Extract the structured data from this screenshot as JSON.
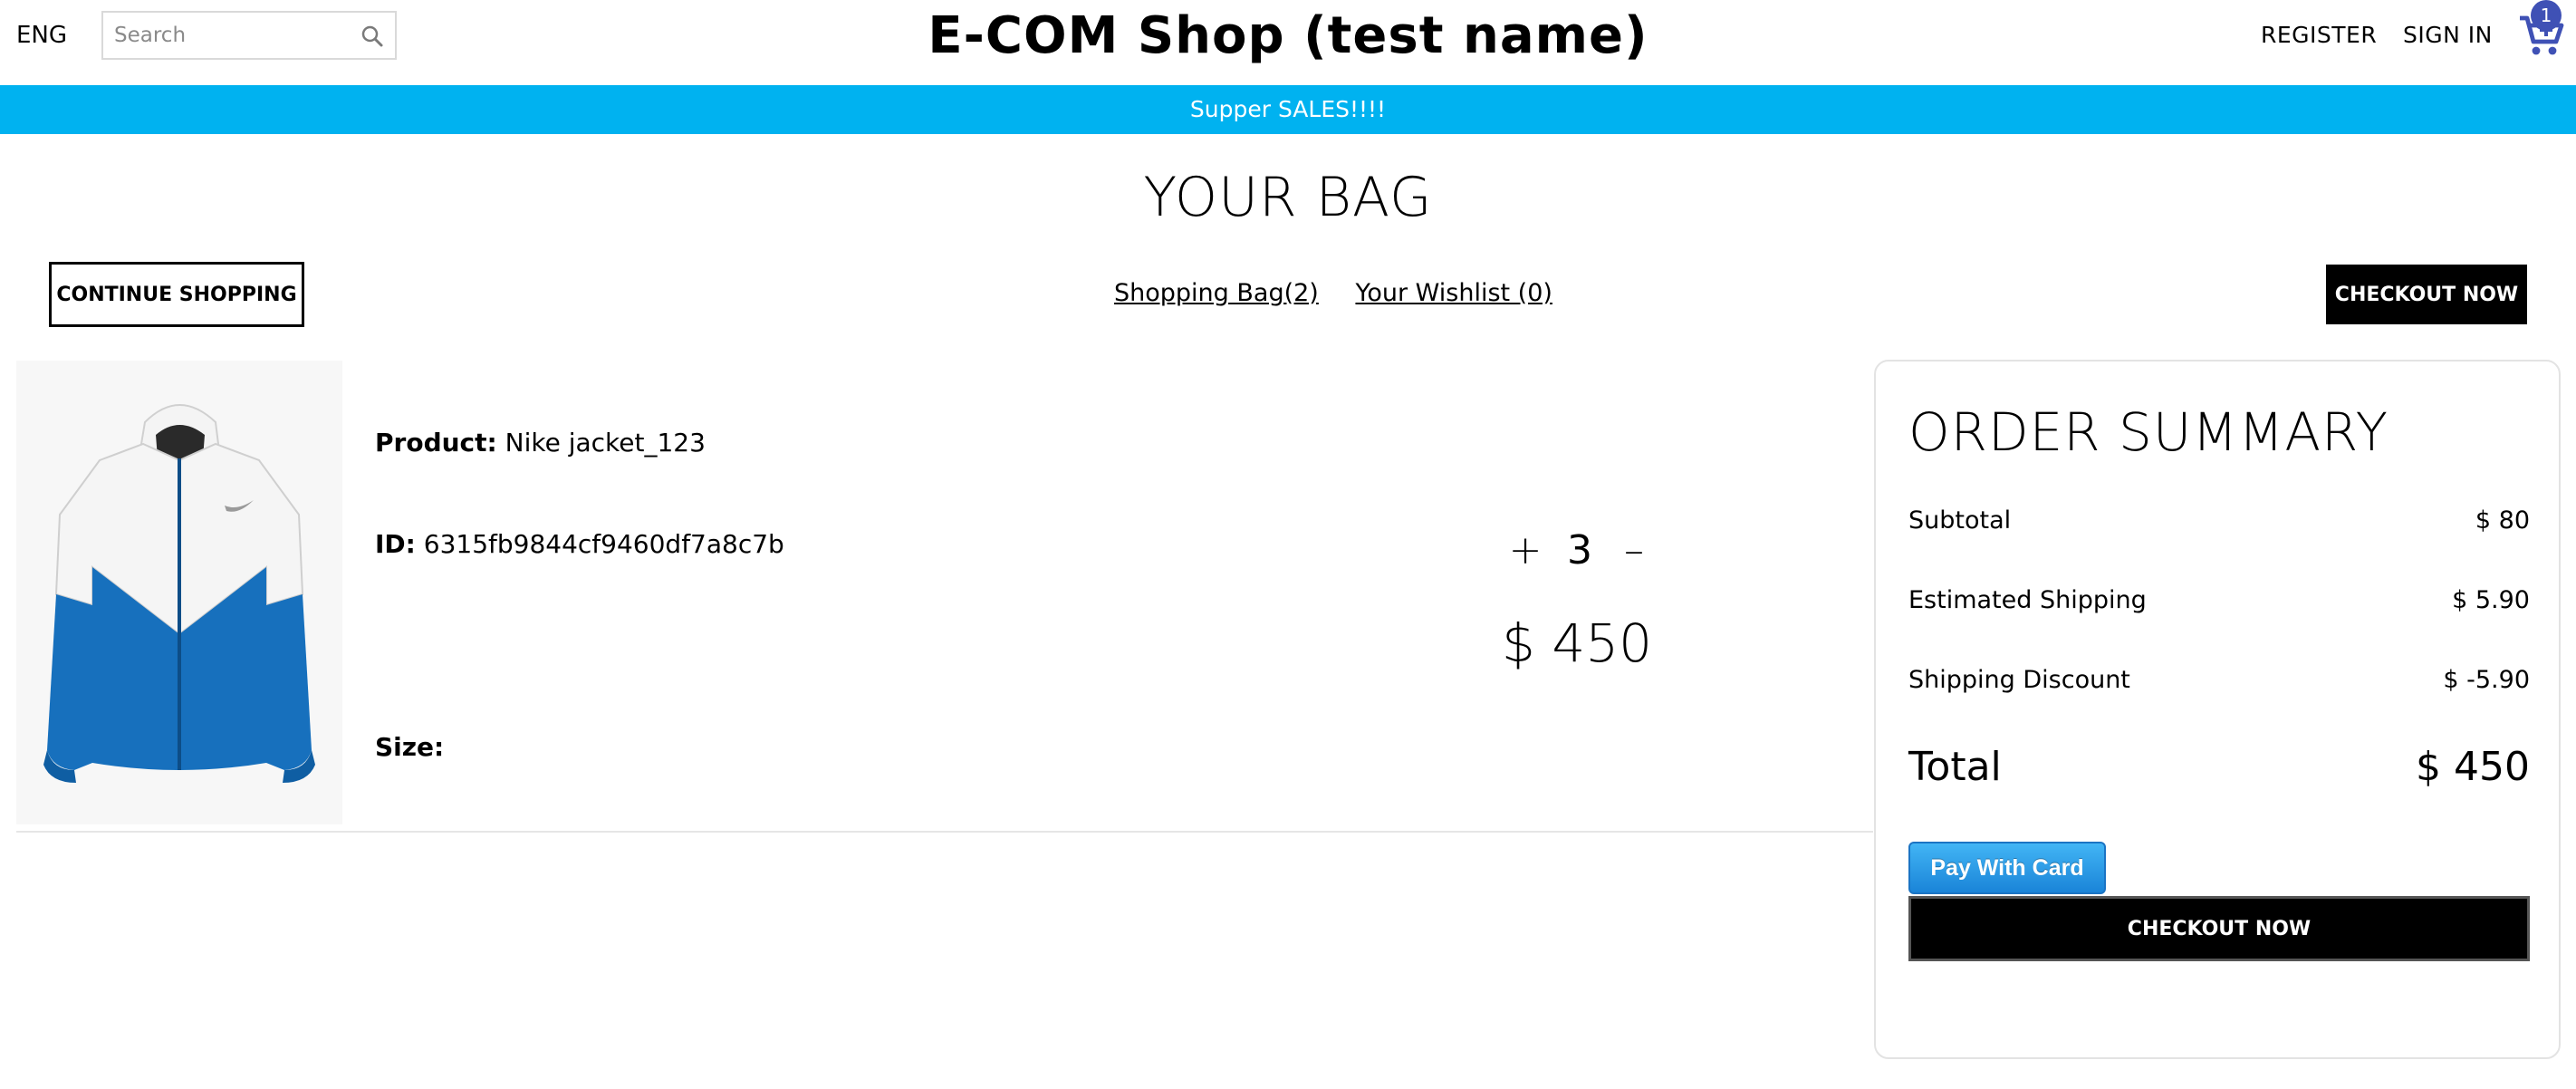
{
  "header": {
    "language": "ENG",
    "search_placeholder": "Search",
    "brand": "E-COM Shop (test name)",
    "register_label": "REGISTER",
    "signin_label": "SIGN IN",
    "cart_count": "1"
  },
  "announcement": "Supper SALES!!!!",
  "page": {
    "title": "YOUR BAG",
    "continue_label": "CONTINUE SHOPPING",
    "bag_link": "Shopping Bag(2)",
    "wishlist_link": "Your Wishlist (0)",
    "checkout_label": "CHECKOUT NOW"
  },
  "cart_item": {
    "product_label": "Product:",
    "product_name": "Nike jacket_123",
    "id_label": "ID:",
    "id_value": "6315fb9844cf9460df7a8c7b",
    "size_label": "Size:",
    "size_value": "",
    "quantity": "3",
    "increase_symbol": "+",
    "decrease_symbol": "–",
    "price": "$ 450",
    "image": "white-blue-hooded-jacket"
  },
  "summary": {
    "title": "ORDER SUMMARY",
    "subtotal_label": "Subtotal",
    "subtotal_value": "$ 80",
    "shipping_label": "Estimated Shipping",
    "shipping_value": "$ 5.90",
    "discount_label": "Shipping Discount",
    "discount_value": "$ -5.90",
    "total_label": "Total",
    "total_value": "$ 450",
    "pay_label": "Pay With Card",
    "checkout_label": "CHECKOUT NOW"
  },
  "colors": {
    "announcement_bg": "#00b2f0",
    "cart_icon": "#3f51b5",
    "pay_button": "#1a84d8"
  }
}
